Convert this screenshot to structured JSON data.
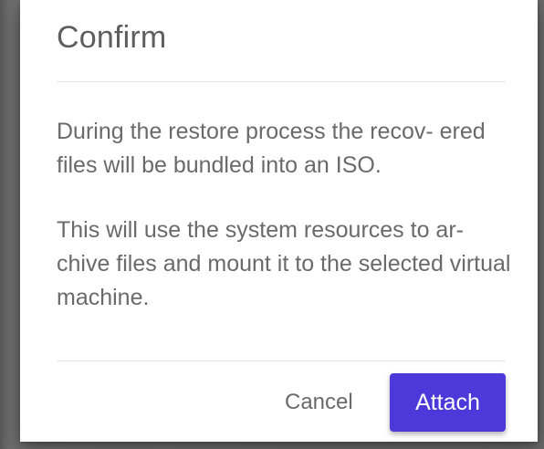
{
  "dialog": {
    "title": "Confirm",
    "paragraphs": [
      "During the restore process the recov- ered files will be bundled into an ISO.",
      "This will use the system resources to ar- chive files and mount it to the selected virtual machine."
    ],
    "cancel_label": "Cancel",
    "attach_label": "Attach"
  },
  "colors": {
    "primary_button": "#4b3ad9",
    "backdrop": "#6f6f6f",
    "text": "#6a6a6a"
  }
}
